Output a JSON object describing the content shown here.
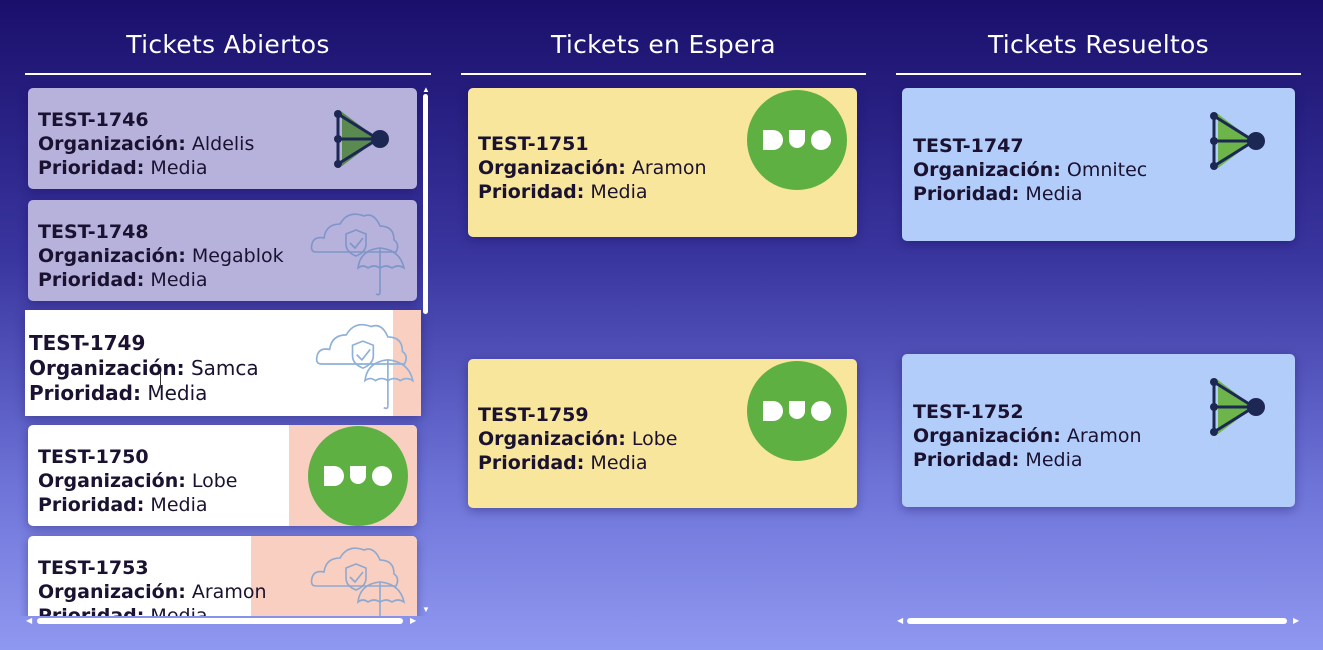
{
  "columns": [
    {
      "title": "Tickets Abiertos",
      "tickets": [
        {
          "id": "TEST-1746",
          "org_label": "Organización:",
          "org": "Aldelis",
          "pri_label": "Prioridad:",
          "pri": "Media",
          "logo": "network-arrow-icon"
        },
        {
          "id": "TEST-1748",
          "org_label": "Organización:",
          "org": "Megablok",
          "pri_label": "Prioridad:",
          "pri": "Media",
          "logo": "cloud-umbrella-icon"
        },
        {
          "id": "TEST-1749",
          "org_label": "Organización:",
          "org": "Samca",
          "pri_label": "Prioridad:",
          "pri": "Media",
          "logo": "cloud-umbrella-icon"
        },
        {
          "id": "TEST-1750",
          "org_label": "Organización:",
          "org": "Lobe",
          "pri_label": "Prioridad:",
          "pri": "Media",
          "logo": "duo-logo-icon"
        },
        {
          "id": "TEST-1753",
          "org_label": "Organización:",
          "org": "Aramon",
          "pri_label": "Prioridad:",
          "pri": "Media",
          "logo": "cloud-umbrella-icon"
        }
      ]
    },
    {
      "title": "Tickets en Espera",
      "tickets": [
        {
          "id": "TEST-1751",
          "org_label": "Organización:",
          "org": "Aramon",
          "pri_label": "Prioridad:",
          "pri": "Media",
          "logo": "duo-logo-icon"
        },
        {
          "id": "TEST-1759",
          "org_label": "Organización:",
          "org": "Lobe",
          "pri_label": "Prioridad:",
          "pri": "Media",
          "logo": "duo-logo-icon"
        }
      ]
    },
    {
      "title": "Tickets Resueltos",
      "tickets": [
        {
          "id": "TEST-1747",
          "org_label": "Organización:",
          "org": "Omnitec",
          "pri_label": "Prioridad:",
          "pri": "Media",
          "logo": "network-arrow-icon"
        },
        {
          "id": "TEST-1752",
          "org_label": "Organización:",
          "org": "Aramon",
          "pri_label": "Prioridad:",
          "pri": "Media",
          "logo": "network-arrow-icon"
        }
      ]
    }
  ],
  "colors": {
    "open_card_muted": "#b6b2dc",
    "open_card_active": "#ffffff",
    "stripe_salmon": "#f8cfc0",
    "waiting_card": "#f8e69c",
    "resolved_card": "#b3cdfb",
    "duo_green": "#5fb043"
  }
}
